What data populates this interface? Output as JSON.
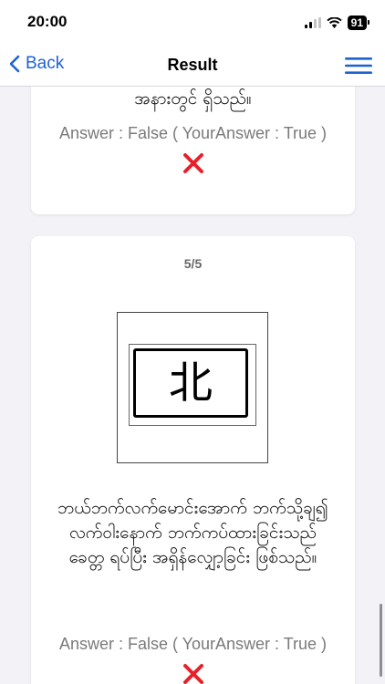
{
  "status_bar": {
    "time": "20:00",
    "battery": "91"
  },
  "nav": {
    "back_label": "Back",
    "title": "Result"
  },
  "questions": [
    {
      "question_text": "အနားတွင် ရှိသည်။",
      "answer_text": "Answer : False ( YourAnswer : True )",
      "result_icon": "x-mark-icon"
    },
    {
      "progress": "5/5",
      "sign_glyph": "北",
      "question_text": "ဘယ်ဘက်လက်မောင်းအောက် ဘက်သို့ချ၍ လက်ဝါးနောက် ဘက်ကပ်ထားခြင်းသည် ခေတ္တ ရပ်ပြီး အရှိန်လျှော့ခြင်း ဖြစ်သည်။",
      "answer_text": "Answer : False ( YourAnswer : True )",
      "result_icon": "x-mark-icon"
    }
  ],
  "colors": {
    "accent": "#1e62d0",
    "wrong": "#e8202a",
    "answer_text": "#7a7a7a"
  }
}
